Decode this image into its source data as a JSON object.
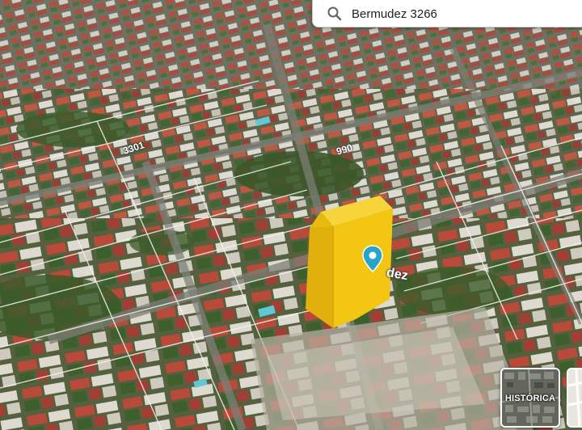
{
  "search": {
    "value": "Bermudez 3266",
    "icon": "search-icon"
  },
  "map": {
    "view": "3d-satellite",
    "road_labels": [
      "3301",
      "990",
      "dez"
    ],
    "highlight_color": "#f2c613",
    "pin_color": "#26a5c9",
    "pin_icon": "map-pin-icon"
  },
  "layers": {
    "historic_label": "HISTÓRICA",
    "historic_icon": "historic-imagery-thumbnail",
    "second_icon": "map-layer-thumbnail"
  }
}
